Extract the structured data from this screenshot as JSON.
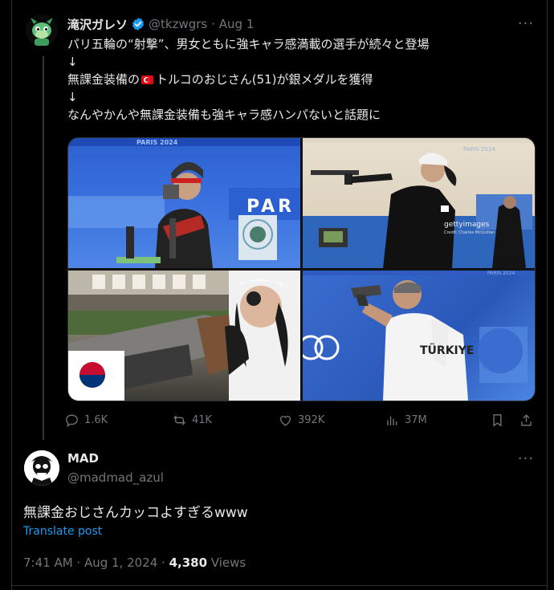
{
  "quoted": {
    "display_name": "滝沢ガレソ",
    "handle": "@tkzwgrs",
    "date": "· Aug 1",
    "lines": [
      "パリ五輪の“射撃”、男女ともに強キャラ感満載の選手が続々と登場",
      "↓",
      "無課金装備の",
      "トルコのおじさん(51)が銀メダルを獲得",
      "↓",
      "なんやかんや無課金装備も強キャラ感ハンパないと話題に"
    ],
    "media": {
      "photo1_text": "PAR",
      "photo1_banner": "PARIS 2024",
      "photo2_banner": "PARIS 2024",
      "photo2_watermark": "gettyimages",
      "photo2_credit": "Credit: Charles McQuillan",
      "photo4_jersey": "TÜRKIYE",
      "photo4_banner": "PARIS 2024"
    },
    "stats": {
      "replies": "1.6K",
      "reposts": "41K",
      "likes": "392K",
      "views": "37M"
    }
  },
  "reply": {
    "display_name": "MAD",
    "handle": "@madmad_azul",
    "text": "無課金おじさんカッコよすぎるwww",
    "translate_label": "Translate post",
    "timestamp": "7:41 AM · Aug 1, 2024 · ",
    "views_count": "4,380",
    "views_label": " Views"
  },
  "colors": {
    "background": "#000000",
    "text": "#e7e9ea",
    "muted": "#71767b",
    "link": "#1d9bf0",
    "verified": "#1d9bf0"
  }
}
